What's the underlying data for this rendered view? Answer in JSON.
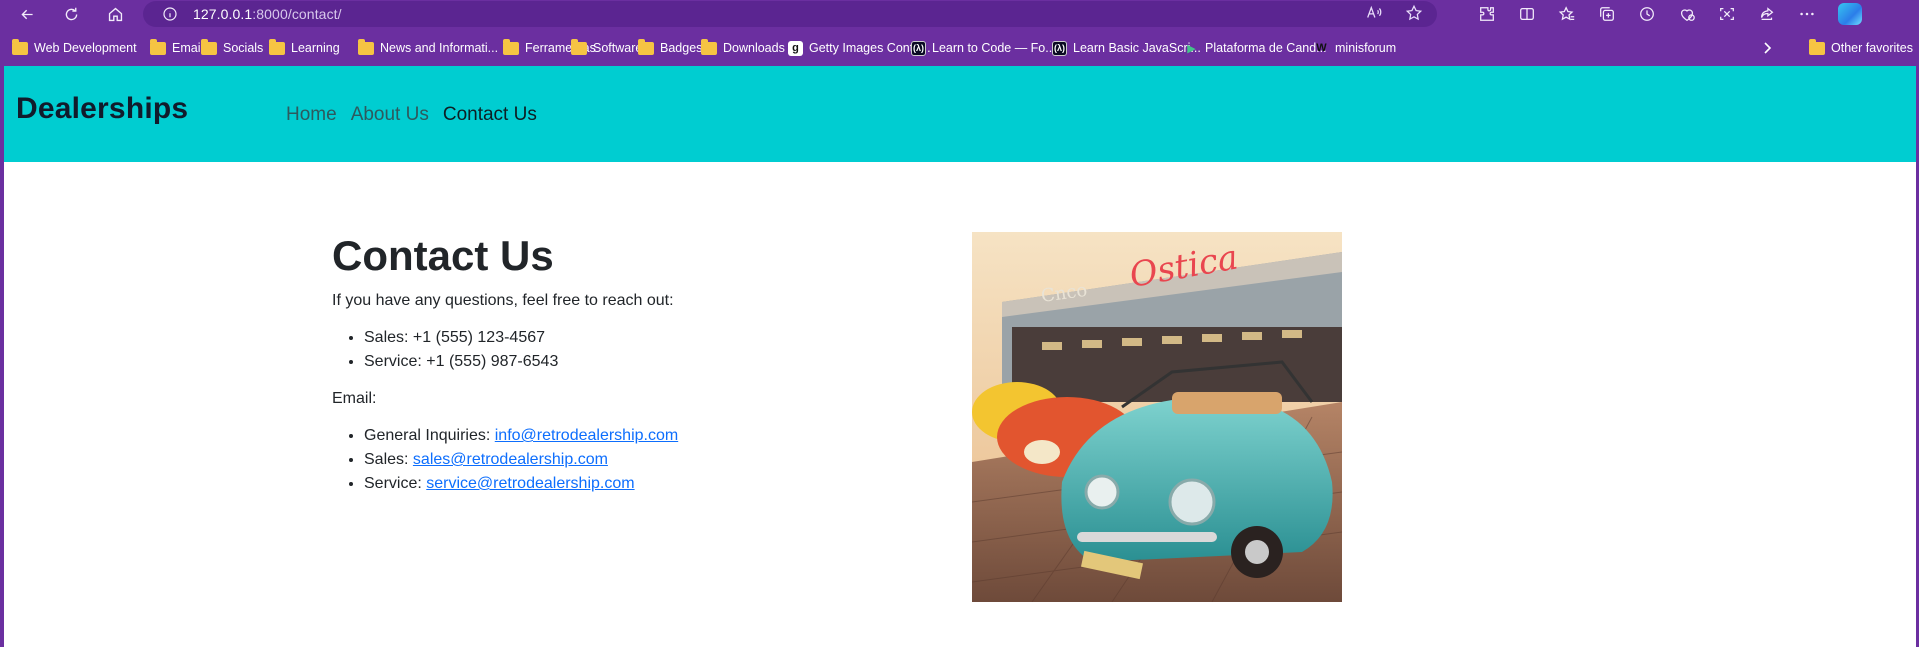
{
  "browser": {
    "url_host": "127.0.0.1",
    "url_path": ":8000/contact/",
    "bookmarks": [
      {
        "label": "Web Development",
        "icon": "folder-icon"
      },
      {
        "label": "Email",
        "icon": "folder-icon"
      },
      {
        "label": "Socials",
        "icon": "folder-icon"
      },
      {
        "label": "Learning",
        "icon": "folder-icon"
      },
      {
        "label": "News and Informati...",
        "icon": "folder-icon"
      },
      {
        "label": "Ferramentas",
        "icon": "folder-icon"
      },
      {
        "label": "Software",
        "icon": "folder-icon"
      },
      {
        "label": "Badges",
        "icon": "folder-icon"
      },
      {
        "label": "Downloads",
        "icon": "folder-icon"
      },
      {
        "label": "Getty Images Contri...",
        "icon": "getty-icon"
      },
      {
        "label": "Learn to Code — Fo...",
        "icon": "freecodecamp-icon"
      },
      {
        "label": "Learn Basic JavaScri...",
        "icon": "freecodecamp-icon"
      },
      {
        "label": "Plataforma de Cand...",
        "icon": "plataforma-icon"
      },
      {
        "label": "minisforum",
        "icon": "minisforum-icon"
      }
    ],
    "other_favorites": "Other favorites"
  },
  "site": {
    "brand": "Dealerships",
    "nav": [
      "Home",
      "About Us",
      "Contact Us"
    ],
    "active_nav": "Contact Us"
  },
  "contact": {
    "title": "Contact Us",
    "intro": "If you have any questions, feel free to reach out:",
    "phones": [
      {
        "label": "Sales:",
        "value": "+1 (555) 123-4567"
      },
      {
        "label": "Service:",
        "value": "+1 (555) 987-6543"
      }
    ],
    "email_label": "Email:",
    "emails": [
      {
        "label": "General Inquiries:",
        "value": "info@retrodealership.com"
      },
      {
        "label": "Sales:",
        "value": "sales@retrodealership.com"
      },
      {
        "label": "Service:",
        "value": "service@retrodealership.com"
      }
    ]
  },
  "colors": {
    "browser_frame": "#6b2fa0",
    "navbar_bg": "#00cdd1",
    "link": "#0d6efd",
    "text": "#212529"
  }
}
